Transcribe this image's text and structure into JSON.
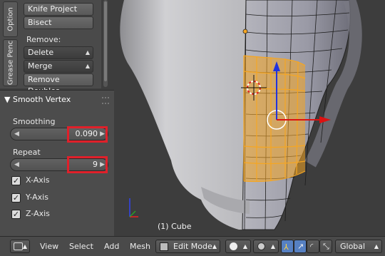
{
  "sidebar": {
    "tabs": [
      "Option",
      "Grease Penc"
    ],
    "buttons": {
      "knife_project": "Knife Project",
      "bisect": "Bisect"
    },
    "remove": {
      "label": "Remove:",
      "delete": "Delete",
      "merge": "Merge",
      "remove_doubles": "Remove Doubles"
    }
  },
  "operator": {
    "title": "Smooth Vertex",
    "smoothing_label": "Smoothing",
    "smoothing_value": "0.090",
    "repeat_label": "Repeat",
    "repeat_value": "9",
    "axes": [
      {
        "label": "X-Axis",
        "checked": true
      },
      {
        "label": "Y-Axis",
        "checked": true
      },
      {
        "label": "Z-Axis",
        "checked": true
      }
    ]
  },
  "viewport": {
    "object_label": "(1) Cube"
  },
  "header": {
    "menus": [
      "View",
      "Select",
      "Add",
      "Mesh"
    ],
    "mode": "Edit Mode",
    "orientation": "Global"
  },
  "colors": {
    "selection": "#f5a623",
    "highlight_box": "#e0202a",
    "y_axis": "#2233dd",
    "x_axis": "#dd1111"
  }
}
